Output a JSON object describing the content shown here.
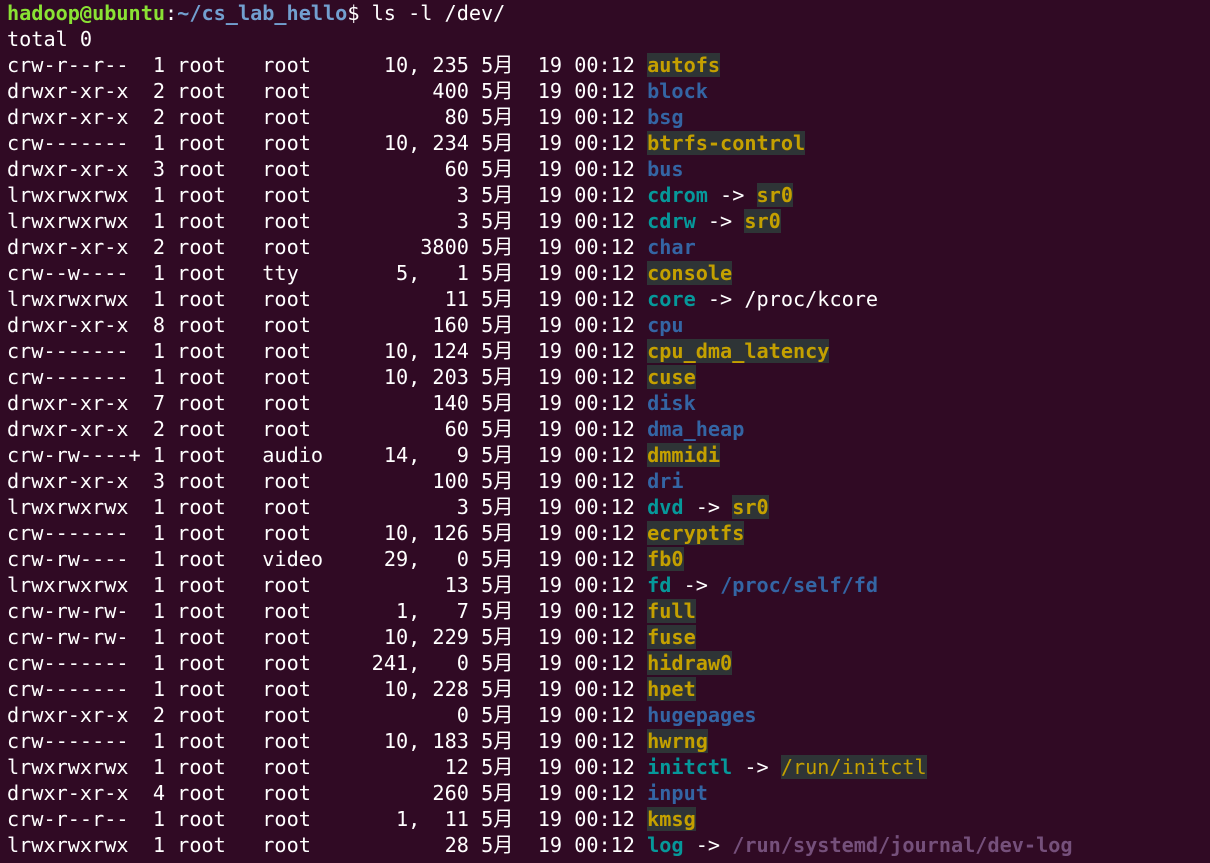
{
  "prompt": {
    "user_host": "hadoop@ubuntu",
    "separator": ":",
    "path": "~/cs_lab_hello",
    "symbol": "$",
    "command": " ls -l /dev/"
  },
  "total_line": "total 0",
  "month": "5月",
  "entries": [
    {
      "perms": "crw-r--r-- ",
      "links": " 1",
      "owner": "root",
      "group": "root ",
      "size": "10, 235",
      "day": "19",
      "time": "00:12",
      "name": "autofs",
      "type": "dev"
    },
    {
      "perms": "drwxr-xr-x ",
      "links": " 2",
      "owner": "root",
      "group": "root ",
      "size": "400",
      "day": "19",
      "time": "00:12",
      "name": "block",
      "type": "dir"
    },
    {
      "perms": "drwxr-xr-x ",
      "links": " 2",
      "owner": "root",
      "group": "root ",
      "size": "80",
      "day": "19",
      "time": "00:12",
      "name": "bsg",
      "type": "dir"
    },
    {
      "perms": "crw------- ",
      "links": " 1",
      "owner": "root",
      "group": "root ",
      "size": "10, 234",
      "day": "19",
      "time": "00:12",
      "name": "btrfs-control",
      "type": "dev"
    },
    {
      "perms": "drwxr-xr-x ",
      "links": " 3",
      "owner": "root",
      "group": "root ",
      "size": "60",
      "day": "19",
      "time": "00:12",
      "name": "bus",
      "type": "dir"
    },
    {
      "perms": "lrwxrwxrwx ",
      "links": " 1",
      "owner": "root",
      "group": "root ",
      "size": "3",
      "day": "19",
      "time": "00:12",
      "name": "cdrom",
      "type": "link",
      "target": "sr0",
      "target_type": "dev"
    },
    {
      "perms": "lrwxrwxrwx ",
      "links": " 1",
      "owner": "root",
      "group": "root ",
      "size": "3",
      "day": "19",
      "time": "00:12",
      "name": "cdrw",
      "type": "link",
      "target": "sr0",
      "target_type": "dev"
    },
    {
      "perms": "drwxr-xr-x ",
      "links": " 2",
      "owner": "root",
      "group": "root ",
      "size": "3800",
      "day": "19",
      "time": "00:12",
      "name": "char",
      "type": "dir"
    },
    {
      "perms": "crw--w---- ",
      "links": " 1",
      "owner": "root",
      "group": "tty  ",
      "size": "5,   1",
      "day": "19",
      "time": "00:12",
      "name": "console",
      "type": "dev"
    },
    {
      "perms": "lrwxrwxrwx ",
      "links": " 1",
      "owner": "root",
      "group": "root ",
      "size": "11",
      "day": "19",
      "time": "00:12",
      "name": "core",
      "type": "link",
      "target": "/proc/kcore",
      "target_type": "plain"
    },
    {
      "perms": "drwxr-xr-x ",
      "links": " 8",
      "owner": "root",
      "group": "root ",
      "size": "160",
      "day": "19",
      "time": "00:12",
      "name": "cpu",
      "type": "dir"
    },
    {
      "perms": "crw------- ",
      "links": " 1",
      "owner": "root",
      "group": "root ",
      "size": "10, 124",
      "day": "19",
      "time": "00:12",
      "name": "cpu_dma_latency",
      "type": "dev"
    },
    {
      "perms": "crw------- ",
      "links": " 1",
      "owner": "root",
      "group": "root ",
      "size": "10, 203",
      "day": "19",
      "time": "00:12",
      "name": "cuse",
      "type": "dev"
    },
    {
      "perms": "drwxr-xr-x ",
      "links": " 7",
      "owner": "root",
      "group": "root ",
      "size": "140",
      "day": "19",
      "time": "00:12",
      "name": "disk",
      "type": "dir"
    },
    {
      "perms": "drwxr-xr-x ",
      "links": " 2",
      "owner": "root",
      "group": "root ",
      "size": "60",
      "day": "19",
      "time": "00:12",
      "name": "dma_heap",
      "type": "dir"
    },
    {
      "perms": "crw-rw----+",
      "links": " 1",
      "owner": "root",
      "group": "audio",
      "size": "14,   9",
      "day": "19",
      "time": "00:12",
      "name": "dmmidi",
      "type": "dev"
    },
    {
      "perms": "drwxr-xr-x ",
      "links": " 3",
      "owner": "root",
      "group": "root ",
      "size": "100",
      "day": "19",
      "time": "00:12",
      "name": "dri",
      "type": "dir"
    },
    {
      "perms": "lrwxrwxrwx ",
      "links": " 1",
      "owner": "root",
      "group": "root ",
      "size": "3",
      "day": "19",
      "time": "00:12",
      "name": "dvd",
      "type": "link",
      "target": "sr0",
      "target_type": "dev"
    },
    {
      "perms": "crw------- ",
      "links": " 1",
      "owner": "root",
      "group": "root ",
      "size": "10, 126",
      "day": "19",
      "time": "00:12",
      "name": "ecryptfs",
      "type": "dev"
    },
    {
      "perms": "crw-rw---- ",
      "links": " 1",
      "owner": "root",
      "group": "video",
      "size": "29,   0",
      "day": "19",
      "time": "00:12",
      "name": "fb0",
      "type": "dev"
    },
    {
      "perms": "lrwxrwxrwx ",
      "links": " 1",
      "owner": "root",
      "group": "root ",
      "size": "13",
      "day": "19",
      "time": "00:12",
      "name": "fd",
      "type": "link",
      "target": "/proc/self/fd",
      "target_type": "dir"
    },
    {
      "perms": "crw-rw-rw- ",
      "links": " 1",
      "owner": "root",
      "group": "root ",
      "size": "1,   7",
      "day": "19",
      "time": "00:12",
      "name": "full",
      "type": "dev"
    },
    {
      "perms": "crw-rw-rw- ",
      "links": " 1",
      "owner": "root",
      "group": "root ",
      "size": "10, 229",
      "day": "19",
      "time": "00:12",
      "name": "fuse",
      "type": "dev"
    },
    {
      "perms": "crw------- ",
      "links": " 1",
      "owner": "root",
      "group": "root ",
      "size": "241,   0",
      "day": "19",
      "time": "00:12",
      "name": "hidraw0",
      "type": "dev"
    },
    {
      "perms": "crw------- ",
      "links": " 1",
      "owner": "root",
      "group": "root ",
      "size": "10, 228",
      "day": "19",
      "time": "00:12",
      "name": "hpet",
      "type": "dev"
    },
    {
      "perms": "drwxr-xr-x ",
      "links": " 2",
      "owner": "root",
      "group": "root ",
      "size": "0",
      "day": "19",
      "time": "00:12",
      "name": "hugepages",
      "type": "dir"
    },
    {
      "perms": "crw------- ",
      "links": " 1",
      "owner": "root",
      "group": "root ",
      "size": "10, 183",
      "day": "19",
      "time": "00:12",
      "name": "hwrng",
      "type": "dev"
    },
    {
      "perms": "lrwxrwxrwx ",
      "links": " 1",
      "owner": "root",
      "group": "root ",
      "size": "12",
      "day": "19",
      "time": "00:12",
      "name": "initctl",
      "type": "link",
      "target": "/run/initctl",
      "target_type": "fifo"
    },
    {
      "perms": "drwxr-xr-x ",
      "links": " 4",
      "owner": "root",
      "group": "root ",
      "size": "260",
      "day": "19",
      "time": "00:12",
      "name": "input",
      "type": "dir"
    },
    {
      "perms": "crw-r--r-- ",
      "links": " 1",
      "owner": "root",
      "group": "root ",
      "size": "1,  11",
      "day": "19",
      "time": "00:12",
      "name": "kmsg",
      "type": "dev"
    },
    {
      "perms": "lrwxrwxrwx ",
      "links": " 1",
      "owner": "root",
      "group": "root ",
      "size": "28",
      "day": "19",
      "time": "00:12",
      "name": "log",
      "type": "link",
      "target": "/run/systemd/journal/dev-log",
      "target_type": "sock"
    }
  ],
  "colors": {
    "background": "#300a24",
    "prompt_user": "#8ae234",
    "prompt_path": "#729fcf",
    "directory": "#3465a4",
    "device": "#c4a000",
    "device_bg": "#2e3436",
    "symlink": "#06989a",
    "socket": "#75507b"
  }
}
